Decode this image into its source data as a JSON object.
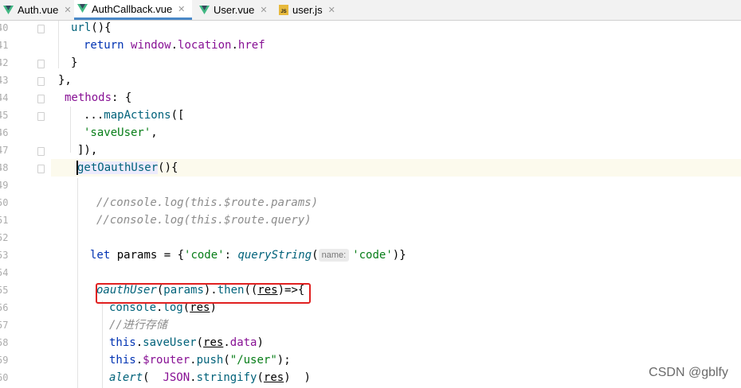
{
  "tabs": [
    {
      "label": "Auth.vue",
      "icon": "vue-icon",
      "active": false
    },
    {
      "label": "AuthCallback.vue",
      "icon": "vue-icon",
      "active": true
    },
    {
      "label": "User.vue",
      "icon": "vue-icon",
      "active": false
    },
    {
      "label": "user.js",
      "icon": "js-file-icon",
      "active": false
    }
  ],
  "close_glyph": "✕",
  "js_badge": "JS",
  "line_numbers": [
    "40",
    "41",
    "42",
    "43",
    "44",
    "45",
    "46",
    "47",
    "48",
    "49",
    "50",
    "51",
    "52",
    "53",
    "54",
    "55",
    "56",
    "57",
    "58",
    "59",
    "60"
  ],
  "code": {
    "l40": {
      "a": "url",
      "b": "(){"
    },
    "l41": {
      "a": "return",
      "b": " ",
      "c": "window",
      "d": ".",
      "e": "location",
      "f": ".",
      "g": "href"
    },
    "l42": {
      "a": "}"
    },
    "l43": {
      "a": "},"
    },
    "l44": {
      "a": "methods",
      "b": ": {"
    },
    "l45": {
      "a": "...",
      "b": "mapActions",
      "c": "(["
    },
    "l46": {
      "a": "'saveUser'",
      "b": ","
    },
    "l47": {
      "a": "]),"
    },
    "l48": {
      "a": "getOauthUser",
      "b": "(){"
    },
    "l50": {
      "a": "//console.log(this.$route.params)"
    },
    "l51": {
      "a": "//console.log(this.$route.query)"
    },
    "l53": {
      "a": "let",
      "b": " params = {",
      "c": "'code'",
      "d": ": ",
      "e": "queryString",
      "f": "(",
      "hint": "name:",
      "g": "'code'",
      "h": ")}"
    },
    "l55": {
      "a": "oauthUser",
      "b": "(",
      "c": "params",
      "d": ").",
      "e": "then",
      "f": "((",
      "g": "res",
      "h": ")=>{"
    },
    "l56": {
      "a": "console",
      "b": ".",
      "c": "log",
      "d": "(",
      "e": "res",
      "f": ")"
    },
    "l57": {
      "a": "//进行存储"
    },
    "l58": {
      "a": "this",
      "b": ".",
      "c": "saveUser",
      "d": "(",
      "e": "res",
      "f": ".",
      "g": "data",
      "h": ")"
    },
    "l59": {
      "a": "this",
      "b": ".",
      "c": "$router",
      "d": ".",
      "e": "push",
      "f": "(",
      "g": "\"/user\"",
      "h": ");"
    },
    "l60": {
      "a": "alert",
      "b": "(  ",
      "c": "JSON",
      "d": ".",
      "e": "stringify",
      "f": "(",
      "g": "res",
      "h": ")  )"
    }
  },
  "watermark": "CSDN @gblfy"
}
